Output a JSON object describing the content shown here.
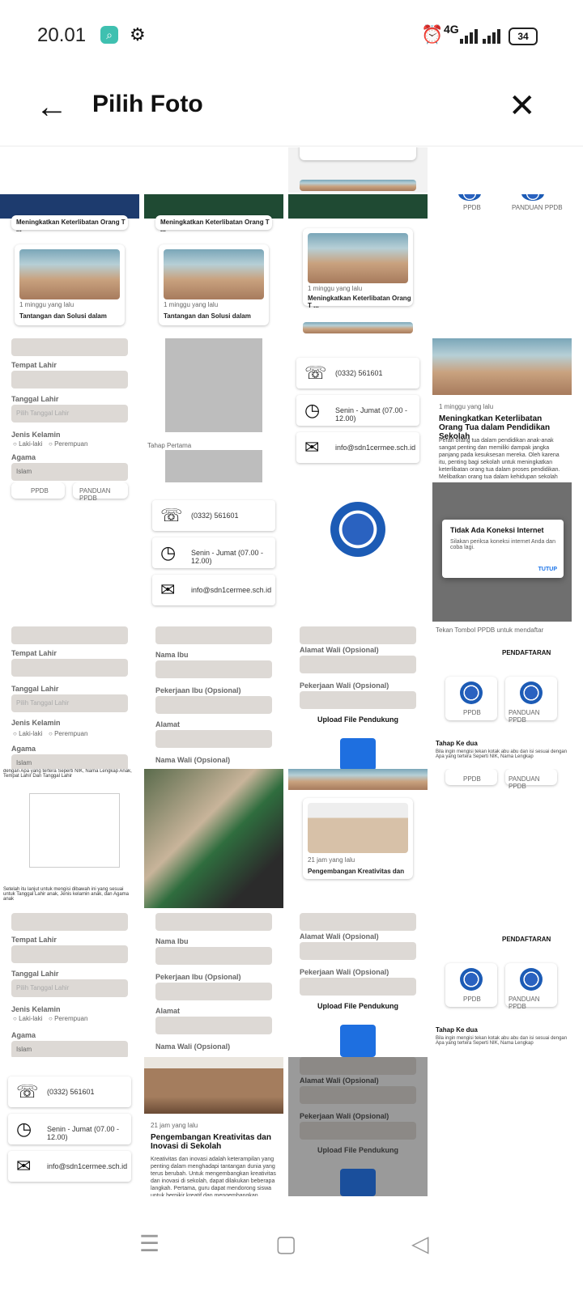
{
  "status": {
    "time": "20.01",
    "network": "4G",
    "battery": "34"
  },
  "header": {
    "title": "Pilih Foto"
  },
  "grid": {
    "row1": {
      "card_title": "Meningkatkan Keterlibatan Orang T ...",
      "time_ago": "1 minggu yang lalu",
      "title2": "Tantangan dan Solusi dalam",
      "label_ppdb": "PPDB",
      "label_panduan": "PANDUAN PPDB"
    },
    "form": {
      "tempat_lahir": "Tempat Lahir",
      "tanggal_lahir": "Tanggal Lahir",
      "tanggal_placeholder": "Pilih Tanggal Lahir",
      "jenis_kelamin": "Jenis Kelamin",
      "laki": "Laki-laki",
      "perempuan": "Perempuan",
      "agama": "Agama",
      "agama_value": "Islam",
      "tahap_pertama": "Tahap Pertama"
    },
    "contact": {
      "phone": "(0332) 561601",
      "hours": "Senin - Jumat (07.00 - 12.00)",
      "email": "info@sdn1cermee.sch.id"
    },
    "article": {
      "time_ago": "1 minggu yang lalu",
      "title": "Meningkatkan Keterlibatan Orang Tua dalam Pendidikan Sekolah",
      "body": "Peran orang tua dalam pendidikan anak-anak sangat penting dan memiliki dampak jangka panjang pada kesuksesan mereka. Oleh karena itu, penting bagi sekolah untuk meningkatkan keterlibatan orang tua dalam proses pendidikan. Melibatkan orang tua dalam kehidupan sekolah"
    },
    "dialog": {
      "title": "Tidak Ada Koneksi Internet",
      "body": "Silakan periksa koneksi internet Anda dan coba lagi.",
      "button": "TUTUP"
    },
    "form2": {
      "nama_ibu": "Nama Ibu",
      "pekerjaan_ibu": "Pekerjaan Ibu (Opsional)",
      "alamat": "Alamat",
      "nama_wali": "Nama Wali (Opsional)",
      "alamat_wali": "Alamat Wali (Opsional)",
      "pekerjaan_wali": "Pekerjaan Wali (Opsional)",
      "upload": "Upload File Pendukung"
    },
    "guide": {
      "tekan": "Tekan Tombol PPDB untuk mendaftar",
      "pendaftaran": "PENDAFTARAN",
      "tahap_dua": "Tahap Ke dua",
      "tahap_dua_body": "Bila ingin mengisi tekan kotak abu abu dan isi sesuai dengan Apa yang tertera Seperti NIK, Nama Lengkap",
      "anak_tempat": "dengan Apa yang tertera Seperti NIK, Nama Lengkap Anak, Tempat Lahir Dan Tanggal Lahir",
      "setelah": "Setelah itu lanjut untuk mengisi dibawah ini yang sesuai untuk Tanggal Lahir anak, Jenis kelamin anak, dan Agama anak"
    },
    "article2": {
      "time_ago": "21 jam yang lalu",
      "title": "Pengembangan Kreativitas dan Inovasi di Sekolah",
      "short_title": "Pengembangan Kreativitas dan",
      "body": "Kreativitas dan inovasi adalah keterampilan yang penting dalam menghadapi tantangan dunia yang terus berubah. Untuk mengembangkan kreativitas dan inovasi di sekolah, dapat dilakukan beberapa langkah. Pertama, guru dapat mendorong siswa untuk berpikir kreatif dan mengembangkan"
    }
  }
}
